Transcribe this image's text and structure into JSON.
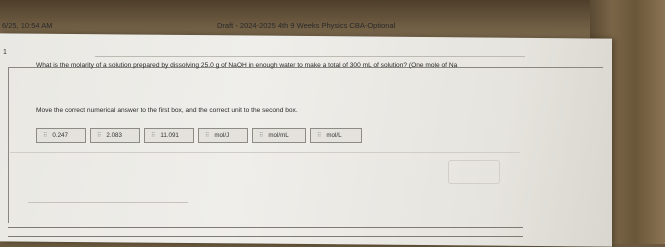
{
  "header": {
    "timestamp": "6/25, 10:54 AM",
    "title": "Draft - 2024-2025 4th 9 Weeks Physics CBA-Optional"
  },
  "question": {
    "number": "1",
    "text": "What is the molarity of a solution prepared by dissolving 25.0 g of NaOH in enough water to make a total of 300 mL of solution? (One mole of Na",
    "instruction": "Move the correct numerical answer to the first box, and the correct unit to the second box."
  },
  "choices": [
    {
      "label": "0.247",
      "grip": "⠿"
    },
    {
      "label": "2.083",
      "grip": "⠿"
    },
    {
      "label": "11.091",
      "grip": "⠿"
    },
    {
      "label": "mol/J",
      "grip": "⠿"
    },
    {
      "label": "mol/mL",
      "grip": "⠿"
    },
    {
      "label": "mol/L",
      "grip": "⠿"
    }
  ]
}
